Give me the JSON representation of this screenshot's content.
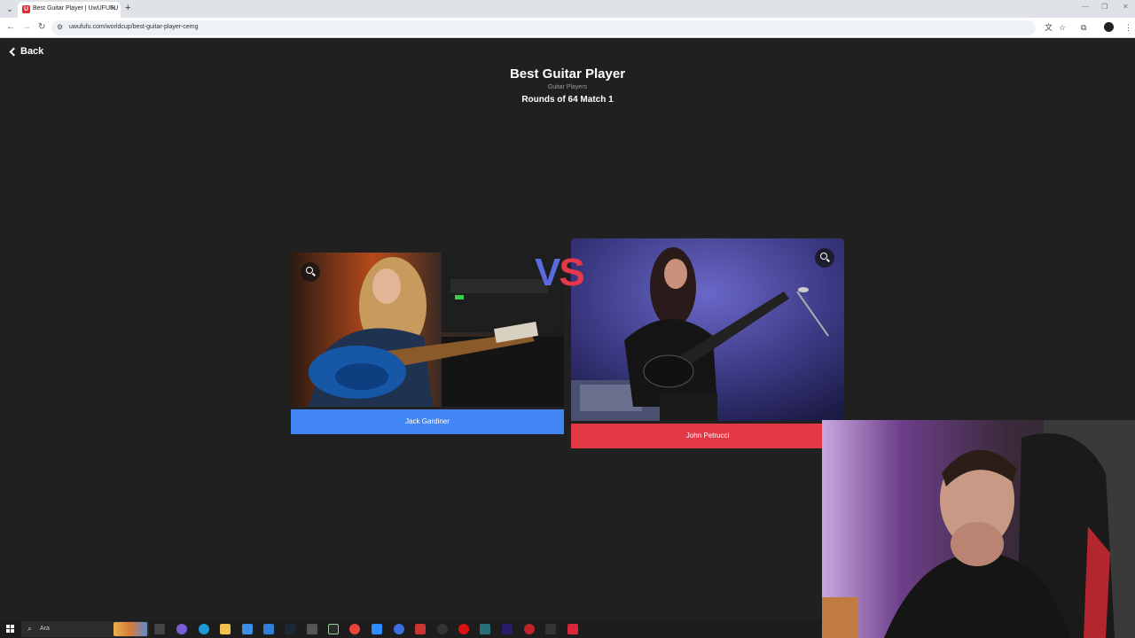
{
  "browser": {
    "tab_title": "Best Guitar Player | UwUFUFU",
    "tab_favicon": "U",
    "url": "uwufufu.com/worldcup/best-guitar-player-cemg"
  },
  "page": {
    "back_label": "Back",
    "title": "Best Guitar Player",
    "subtitle": "Guitar Players",
    "round": "Rounds of 64 Match 1",
    "vs_v": "V",
    "vs_s": "S"
  },
  "candidates": [
    {
      "name": "Jack Gardiner",
      "button_color": "#4285f4"
    },
    {
      "name": "John Petrucci",
      "button_color": "#e23745"
    }
  ],
  "taskbar": {
    "search_placeholder": "Ara"
  },
  "colors": {
    "page_bg": "#202020",
    "left_button": "#4285f4",
    "right_button": "#e23745",
    "vs_left": "#5a6adf",
    "vs_right": "#e5384a"
  }
}
